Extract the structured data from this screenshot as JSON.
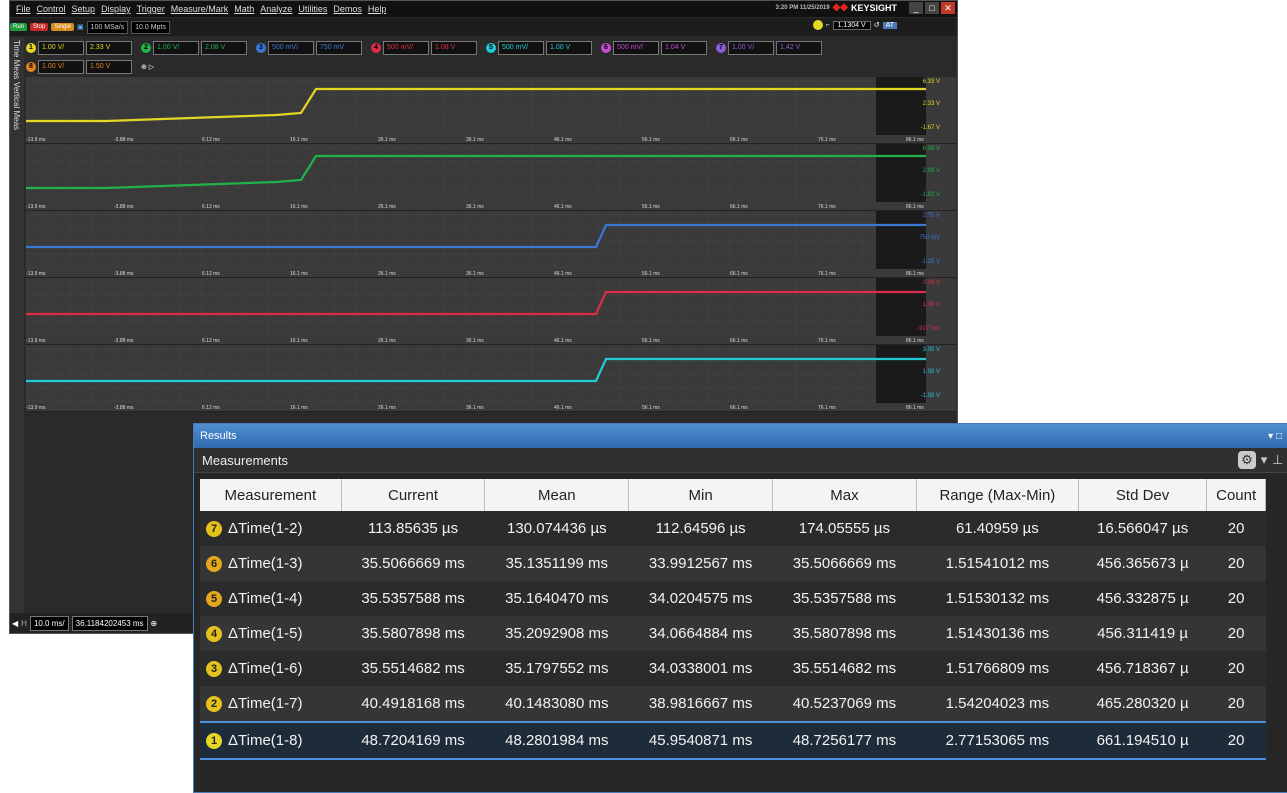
{
  "menu": [
    "File",
    "Control",
    "Setup",
    "Display",
    "Trigger",
    "Measure/Mark",
    "Math",
    "Analyze",
    "Utilities",
    "Demos",
    "Help"
  ],
  "brand": {
    "name": "KEYSIGHT",
    "timestamp": "3:20 PM 11/25/2019"
  },
  "toolbar": {
    "run": "Run",
    "stop": "Stop",
    "single": "Single",
    "sample_rate": "100 MSa/s",
    "memory_depth": "10.0 Mpts"
  },
  "trigger": {
    "level": "1.1304 V"
  },
  "sidebar": {
    "time_meas": "Time Meas",
    "vertical_meas": "Vertical Meas"
  },
  "channels": [
    {
      "num": "1",
      "scale": "1.00 V/",
      "offset": "2.33 V",
      "color": "#e4d624"
    },
    {
      "num": "2",
      "scale": "1.00 V/",
      "offset": "2.08 V",
      "color": "#21b24a"
    },
    {
      "num": "3",
      "scale": "500 mV/",
      "offset": "750 mV",
      "color": "#3a78d6"
    },
    {
      "num": "4",
      "scale": "500 mV/",
      "offset": "1.08 V",
      "color": "#dd2c4a"
    },
    {
      "num": "5",
      "scale": "500 mV/",
      "offset": "1.00 V",
      "color": "#22c9d6"
    },
    {
      "num": "6",
      "scale": "500 mV/",
      "offset": "1.04 V",
      "color": "#c44ad0"
    },
    {
      "num": "7",
      "scale": "1.00 V/",
      "offset": "1.42 V",
      "color": "#8a5fd6"
    },
    {
      "num": "8",
      "scale": "1.00 V/",
      "offset": "1.50 V",
      "color": "#e0851c"
    }
  ],
  "time_axis": [
    "-13.9 ms",
    "-3.88 ms",
    "6.12 ms",
    "16.1 ms",
    "26.1 ms",
    "36.1 ms",
    "46.1 ms",
    "56.1 ms",
    "66.1 ms",
    "76.1 ms",
    "86.1 ms"
  ],
  "panels": [
    {
      "scale_top": "6.33 V",
      "scale_mid": "2.33 V",
      "scale_bot": "-1.67 V",
      "ch": "1"
    },
    {
      "scale_top": "6.08 V",
      "scale_mid": "2.08 V",
      "scale_bot": "-1.92 V",
      "ch": "2"
    },
    {
      "scale_top": "2.75 V",
      "scale_mid": "750 mV",
      "scale_bot": "-1.25 V",
      "ch": "3"
    },
    {
      "scale_top": "3.08 V",
      "scale_mid": "1.08 V",
      "scale_bot": "-917 mV",
      "ch": "4"
    },
    {
      "scale_top": "3.00 V",
      "scale_mid": "1.00 V",
      "scale_bot": "-1.00 V",
      "ch": ""
    }
  ],
  "bottombar": {
    "timebase": "10.0 ms/",
    "position": "36.1184202453 ms"
  },
  "results": {
    "title": "Results",
    "section": "Measurements",
    "columns": [
      "Measurement",
      "Current",
      "Mean",
      "Min",
      "Max",
      "Range (Max-Min)",
      "Std Dev",
      "Count"
    ],
    "rows": [
      {
        "badge": "7",
        "badge_color": "#e4c21c",
        "name": "ΔTime(1-2)",
        "current": "113.85635 µs",
        "mean": "130.074436 µs",
        "min": "112.64596 µs",
        "max": "174.05555 µs",
        "range": "61.40959 µs",
        "std": "16.566047 µs",
        "count": "20"
      },
      {
        "badge": "6",
        "badge_color": "#e4a81c",
        "name": "ΔTime(1-3)",
        "current": "35.5066669 ms",
        "mean": "35.1351199 ms",
        "min": "33.9912567 ms",
        "max": "35.5066669 ms",
        "range": "1.51541012 ms",
        "std": "456.365673 µ",
        "count": "20"
      },
      {
        "badge": "5",
        "badge_color": "#e4a81c",
        "name": "ΔTime(1-4)",
        "current": "35.5357588 ms",
        "mean": "35.1640470 ms",
        "min": "34.0204575 ms",
        "max": "35.5357588 ms",
        "range": "1.51530132 ms",
        "std": "456.332875 µ",
        "count": "20"
      },
      {
        "badge": "4",
        "badge_color": "#e4c21c",
        "name": "ΔTime(1-5)",
        "current": "35.5807898 ms",
        "mean": "35.2092908 ms",
        "min": "34.0664884 ms",
        "max": "35.5807898 ms",
        "range": "1.51430136 ms",
        "std": "456.311419 µ",
        "count": "20"
      },
      {
        "badge": "3",
        "badge_color": "#e4c21c",
        "name": "ΔTime(1-6)",
        "current": "35.5514682 ms",
        "mean": "35.1797552 ms",
        "min": "34.0338001 ms",
        "max": "35.5514682 ms",
        "range": "1.51766809 ms",
        "std": "456.718367 µ",
        "count": "20"
      },
      {
        "badge": "2",
        "badge_color": "#e4c21c",
        "name": "ΔTime(1-7)",
        "current": "40.4918168 ms",
        "mean": "40.1483080 ms",
        "min": "38.9816667 ms",
        "max": "40.5237069 ms",
        "range": "1.54204023 ms",
        "std": "465.280320 µ",
        "count": "20"
      },
      {
        "badge": "1",
        "badge_color": "#e4d624",
        "name": "ΔTime(1-8)",
        "current": "48.7204169 ms",
        "mean": "48.2801984 ms",
        "min": "45.9540871 ms",
        "max": "48.7256177 ms",
        "range": "2.77153065 ms",
        "std": "661.194510 µ",
        "count": "20"
      }
    ]
  }
}
